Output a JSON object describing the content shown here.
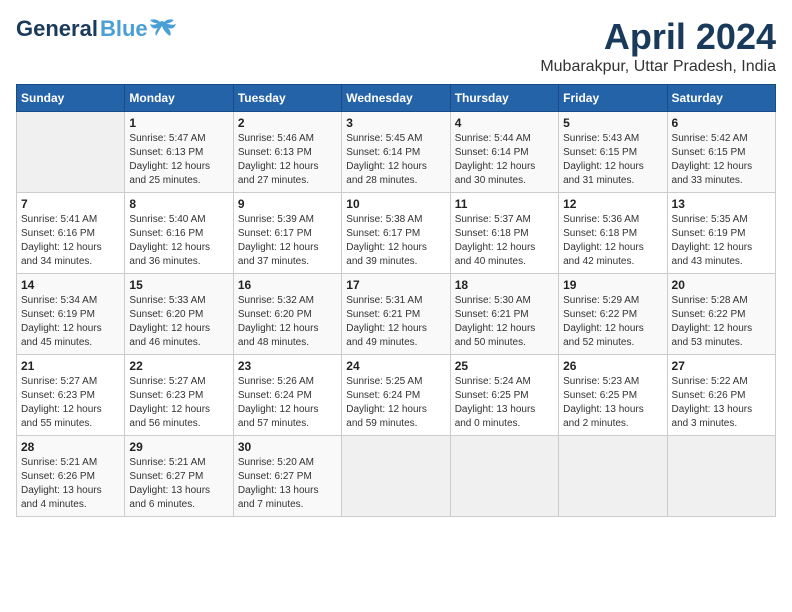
{
  "header": {
    "logo_general": "General",
    "logo_blue": "Blue",
    "month_title": "April 2024",
    "subtitle": "Mubarakpur, Uttar Pradesh, India"
  },
  "days_of_week": [
    "Sunday",
    "Monday",
    "Tuesday",
    "Wednesday",
    "Thursday",
    "Friday",
    "Saturday"
  ],
  "weeks": [
    [
      {
        "day": "",
        "info": ""
      },
      {
        "day": "1",
        "info": "Sunrise: 5:47 AM\nSunset: 6:13 PM\nDaylight: 12 hours\nand 25 minutes."
      },
      {
        "day": "2",
        "info": "Sunrise: 5:46 AM\nSunset: 6:13 PM\nDaylight: 12 hours\nand 27 minutes."
      },
      {
        "day": "3",
        "info": "Sunrise: 5:45 AM\nSunset: 6:14 PM\nDaylight: 12 hours\nand 28 minutes."
      },
      {
        "day": "4",
        "info": "Sunrise: 5:44 AM\nSunset: 6:14 PM\nDaylight: 12 hours\nand 30 minutes."
      },
      {
        "day": "5",
        "info": "Sunrise: 5:43 AM\nSunset: 6:15 PM\nDaylight: 12 hours\nand 31 minutes."
      },
      {
        "day": "6",
        "info": "Sunrise: 5:42 AM\nSunset: 6:15 PM\nDaylight: 12 hours\nand 33 minutes."
      }
    ],
    [
      {
        "day": "7",
        "info": "Sunrise: 5:41 AM\nSunset: 6:16 PM\nDaylight: 12 hours\nand 34 minutes."
      },
      {
        "day": "8",
        "info": "Sunrise: 5:40 AM\nSunset: 6:16 PM\nDaylight: 12 hours\nand 36 minutes."
      },
      {
        "day": "9",
        "info": "Sunrise: 5:39 AM\nSunset: 6:17 PM\nDaylight: 12 hours\nand 37 minutes."
      },
      {
        "day": "10",
        "info": "Sunrise: 5:38 AM\nSunset: 6:17 PM\nDaylight: 12 hours\nand 39 minutes."
      },
      {
        "day": "11",
        "info": "Sunrise: 5:37 AM\nSunset: 6:18 PM\nDaylight: 12 hours\nand 40 minutes."
      },
      {
        "day": "12",
        "info": "Sunrise: 5:36 AM\nSunset: 6:18 PM\nDaylight: 12 hours\nand 42 minutes."
      },
      {
        "day": "13",
        "info": "Sunrise: 5:35 AM\nSunset: 6:19 PM\nDaylight: 12 hours\nand 43 minutes."
      }
    ],
    [
      {
        "day": "14",
        "info": "Sunrise: 5:34 AM\nSunset: 6:19 PM\nDaylight: 12 hours\nand 45 minutes."
      },
      {
        "day": "15",
        "info": "Sunrise: 5:33 AM\nSunset: 6:20 PM\nDaylight: 12 hours\nand 46 minutes."
      },
      {
        "day": "16",
        "info": "Sunrise: 5:32 AM\nSunset: 6:20 PM\nDaylight: 12 hours\nand 48 minutes."
      },
      {
        "day": "17",
        "info": "Sunrise: 5:31 AM\nSunset: 6:21 PM\nDaylight: 12 hours\nand 49 minutes."
      },
      {
        "day": "18",
        "info": "Sunrise: 5:30 AM\nSunset: 6:21 PM\nDaylight: 12 hours\nand 50 minutes."
      },
      {
        "day": "19",
        "info": "Sunrise: 5:29 AM\nSunset: 6:22 PM\nDaylight: 12 hours\nand 52 minutes."
      },
      {
        "day": "20",
        "info": "Sunrise: 5:28 AM\nSunset: 6:22 PM\nDaylight: 12 hours\nand 53 minutes."
      }
    ],
    [
      {
        "day": "21",
        "info": "Sunrise: 5:27 AM\nSunset: 6:23 PM\nDaylight: 12 hours\nand 55 minutes."
      },
      {
        "day": "22",
        "info": "Sunrise: 5:27 AM\nSunset: 6:23 PM\nDaylight: 12 hours\nand 56 minutes."
      },
      {
        "day": "23",
        "info": "Sunrise: 5:26 AM\nSunset: 6:24 PM\nDaylight: 12 hours\nand 57 minutes."
      },
      {
        "day": "24",
        "info": "Sunrise: 5:25 AM\nSunset: 6:24 PM\nDaylight: 12 hours\nand 59 minutes."
      },
      {
        "day": "25",
        "info": "Sunrise: 5:24 AM\nSunset: 6:25 PM\nDaylight: 13 hours\nand 0 minutes."
      },
      {
        "day": "26",
        "info": "Sunrise: 5:23 AM\nSunset: 6:25 PM\nDaylight: 13 hours\nand 2 minutes."
      },
      {
        "day": "27",
        "info": "Sunrise: 5:22 AM\nSunset: 6:26 PM\nDaylight: 13 hours\nand 3 minutes."
      }
    ],
    [
      {
        "day": "28",
        "info": "Sunrise: 5:21 AM\nSunset: 6:26 PM\nDaylight: 13 hours\nand 4 minutes."
      },
      {
        "day": "29",
        "info": "Sunrise: 5:21 AM\nSunset: 6:27 PM\nDaylight: 13 hours\nand 6 minutes."
      },
      {
        "day": "30",
        "info": "Sunrise: 5:20 AM\nSunset: 6:27 PM\nDaylight: 13 hours\nand 7 minutes."
      },
      {
        "day": "",
        "info": ""
      },
      {
        "day": "",
        "info": ""
      },
      {
        "day": "",
        "info": ""
      },
      {
        "day": "",
        "info": ""
      }
    ]
  ]
}
